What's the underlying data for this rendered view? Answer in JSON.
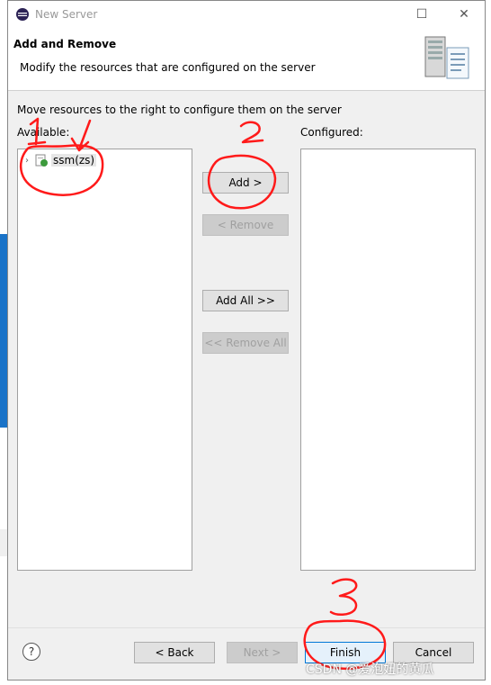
{
  "window": {
    "title": "New Server",
    "controls": {
      "minimize": "☐",
      "close": "✕"
    },
    "icons": {
      "app": "eclipse-icon"
    }
  },
  "header": {
    "title": "Add and Remove",
    "description": "Modify the resources that are configured on the server",
    "graphic": "server-wizard-icon"
  },
  "content": {
    "instruction": "Move resources to the right to configure them on the server",
    "available_label": "Available:",
    "configured_label": "Configured:",
    "available_items": [
      {
        "label": "ssm(zs)",
        "icon": "web-project-icon",
        "expandable": true
      }
    ],
    "configured_items": []
  },
  "buttons": {
    "add": "Add >",
    "remove": "< Remove",
    "add_all": "Add All >>",
    "remove_all": "<< Remove All"
  },
  "footer": {
    "help": "?",
    "back": "< Back",
    "next": "Next >",
    "finish": "Finish",
    "cancel": "Cancel"
  },
  "annotations": [
    "1",
    "2",
    "3"
  ],
  "watermark": "CSDN @爱泡妞的黄瓜",
  "colors": {
    "accent": "#0078d7",
    "annotation": "#ff0000",
    "background_app": "#1a73c8"
  }
}
